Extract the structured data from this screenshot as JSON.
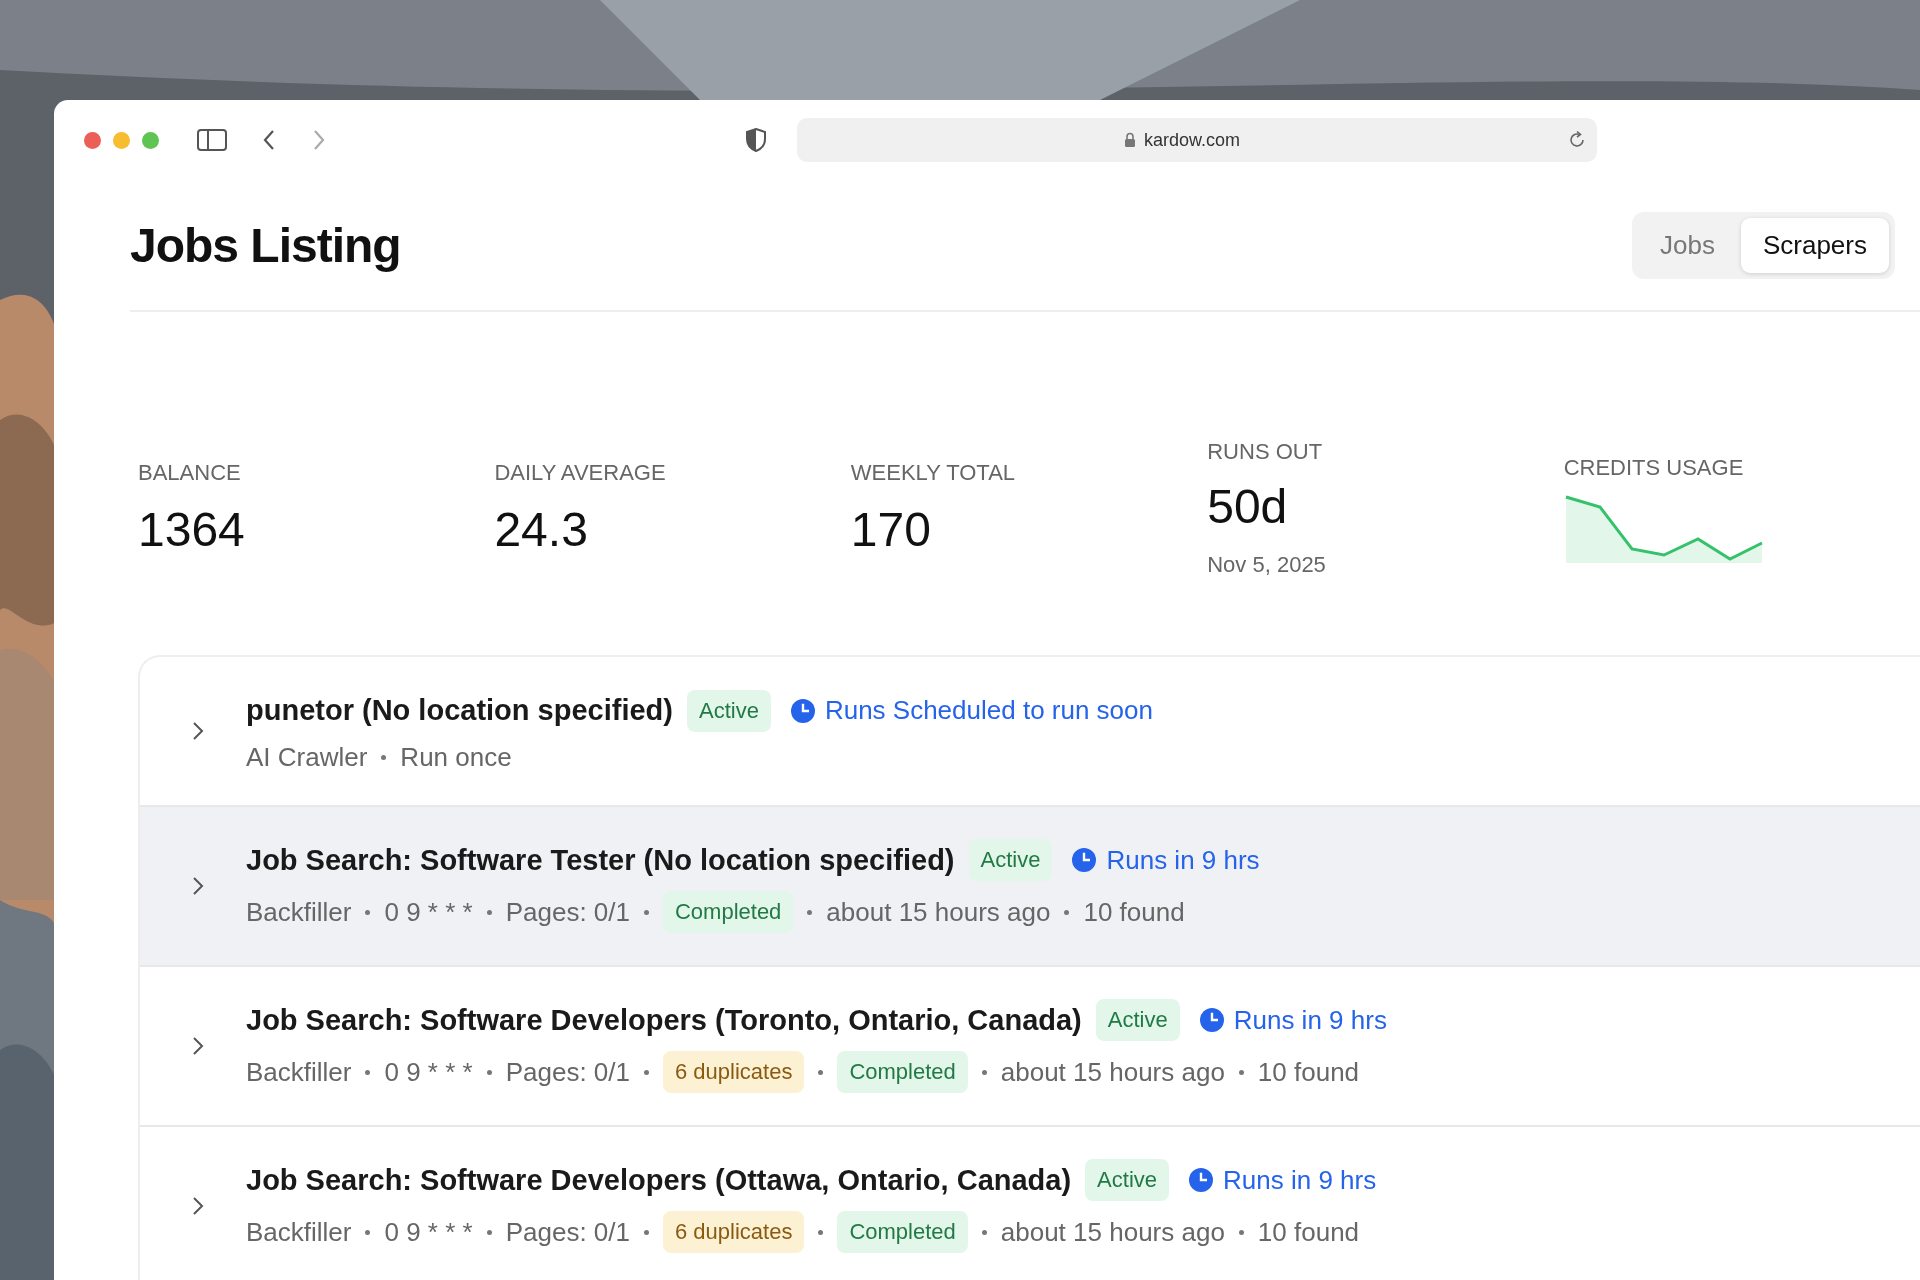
{
  "browser": {
    "address": "kardow.com"
  },
  "page": {
    "title": "Jobs Listing",
    "tabs": [
      {
        "label": "Jobs",
        "selected": false
      },
      {
        "label": "Scrapers",
        "selected": true
      }
    ]
  },
  "stats": [
    {
      "label": "BALANCE",
      "value": "1364"
    },
    {
      "label": "DAILY AVERAGE",
      "value": "24.3"
    },
    {
      "label": "WEEKLY TOTAL",
      "value": "170"
    },
    {
      "label": "RUNS OUT",
      "value": "50d",
      "note": "Nov 5, 2025"
    }
  ],
  "credits_usage": {
    "label": "CREDITS USAGE"
  },
  "scrapers": [
    {
      "title": "punetor (No location specified)",
      "status": "Active",
      "schedule": "Runs Scheduled to run soon",
      "highlighted": false,
      "meta": [
        {
          "kind": "text",
          "text": "AI Crawler"
        },
        {
          "kind": "text",
          "text": "Run once"
        }
      ]
    },
    {
      "title": "Job Search: Software Tester (No location specified)",
      "status": "Active",
      "schedule": "Runs in 9 hrs",
      "highlighted": true,
      "meta": [
        {
          "kind": "text",
          "text": "Backfiller"
        },
        {
          "kind": "text",
          "text": "0 9 * * *"
        },
        {
          "kind": "text",
          "text": "Pages: 0/1"
        },
        {
          "kind": "success",
          "text": "Completed"
        },
        {
          "kind": "text",
          "text": "about 15 hours ago"
        },
        {
          "kind": "text",
          "text": "10 found"
        }
      ]
    },
    {
      "title": "Job Search: Software Developers (Toronto, Ontario, Canada)",
      "status": "Active",
      "schedule": "Runs in 9 hrs",
      "highlighted": false,
      "meta": [
        {
          "kind": "text",
          "text": "Backfiller"
        },
        {
          "kind": "text",
          "text": "0 9 * * *"
        },
        {
          "kind": "text",
          "text": "Pages: 0/1"
        },
        {
          "kind": "warning",
          "text": "6 duplicates"
        },
        {
          "kind": "success",
          "text": "Completed"
        },
        {
          "kind": "text",
          "text": "about 15 hours ago"
        },
        {
          "kind": "text",
          "text": "10 found"
        }
      ]
    },
    {
      "title": "Job Search: Software Developers (Ottawa, Ontario, Canada)",
      "status": "Active",
      "schedule": "Runs in 9 hrs",
      "highlighted": false,
      "meta": [
        {
          "kind": "text",
          "text": "Backfiller"
        },
        {
          "kind": "text",
          "text": "0 9 * * *"
        },
        {
          "kind": "text",
          "text": "Pages: 0/1"
        },
        {
          "kind": "warning",
          "text": "6 duplicates"
        },
        {
          "kind": "success",
          "text": "Completed"
        },
        {
          "kind": "text",
          "text": "about 15 hours ago"
        },
        {
          "kind": "text",
          "text": "10 found"
        }
      ]
    }
  ]
}
